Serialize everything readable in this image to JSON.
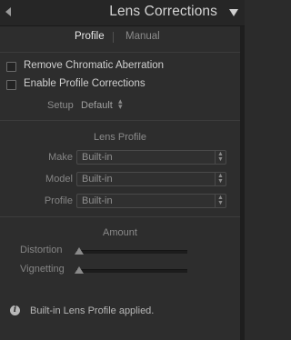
{
  "header": {
    "title": "Lens Corrections"
  },
  "tabs": {
    "profile": "Profile",
    "manual": "Manual"
  },
  "options": [
    {
      "label": "Remove Chromatic Aberration",
      "checked": false
    },
    {
      "label": "Enable Profile Corrections",
      "checked": false
    }
  ],
  "setup": {
    "label": "Setup",
    "value": "Default"
  },
  "lens_profile": {
    "title": "Lens Profile",
    "fields": [
      {
        "label": "Make",
        "value": "Built-in"
      },
      {
        "label": "Model",
        "value": "Built-in"
      },
      {
        "label": "Profile",
        "value": "Built-in"
      }
    ]
  },
  "amount": {
    "title": "Amount",
    "sliders": [
      {
        "label": "Distortion",
        "value": 0
      },
      {
        "label": "Vignetting",
        "value": 0
      }
    ]
  },
  "status": {
    "message": "Built-in Lens Profile applied."
  },
  "colors": {
    "background": "#2d2d2d",
    "header": "#262626",
    "text": "#c8c8c8"
  }
}
